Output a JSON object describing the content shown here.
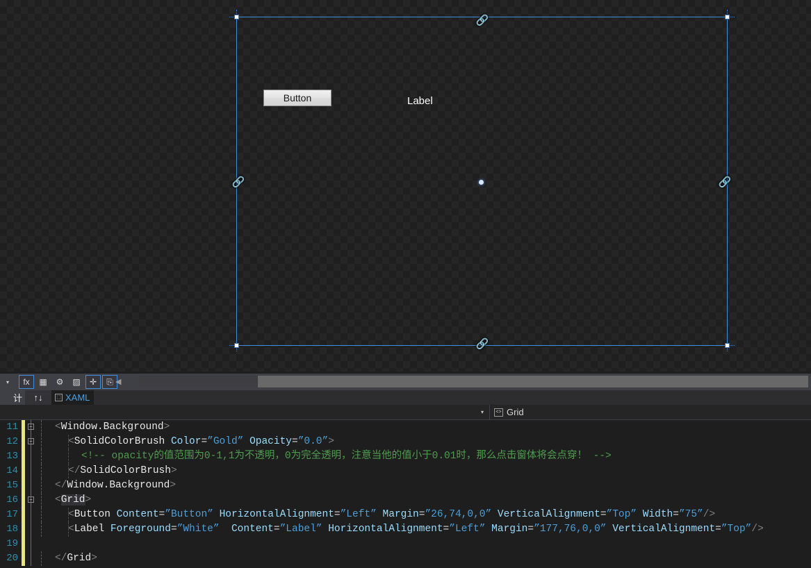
{
  "app": {
    "theme_bg": "#1e1e1e",
    "accent": "#3f8fe0",
    "selection_blue": "#2f6fbf"
  },
  "design_surface": {
    "controls": [
      {
        "name": "button",
        "text": "Button"
      },
      {
        "name": "label",
        "text": "Label"
      }
    ],
    "anchors": {
      "top_chain": "🔗",
      "bottom_chain": "🔗",
      "left_chain": "🔗",
      "right_chain": "🔗"
    }
  },
  "toolbar": {
    "combo_caret": "▾",
    "buttons": [
      {
        "name": "effects-fx",
        "glyph": "fx",
        "selected": true
      },
      {
        "name": "grid-view",
        "glyph": "▦",
        "selected": false
      },
      {
        "name": "snap-settings",
        "glyph": "⚙",
        "selected": false
      },
      {
        "name": "transparency-grid",
        "glyph": "▨",
        "selected": false
      },
      {
        "name": "snap-to-guides",
        "glyph": "✛",
        "selected": true
      },
      {
        "name": "snap-to-gridlines",
        "glyph": "⎘",
        "selected": true
      }
    ],
    "collapse_arrow": "◀"
  },
  "tabs": {
    "design_label": "计",
    "swap_icon": "↑↓",
    "xaml_label": "XAML",
    "xaml_glyph": "⬚"
  },
  "navbar": {
    "left_value": "",
    "left_caret": "▾",
    "right_glyph": "<>",
    "right_value": "Grid"
  },
  "editor": {
    "lines": [
      {
        "number": "11",
        "changed": true,
        "outline": "collapse",
        "indent": 1,
        "tokens": [
          {
            "t": "punct",
            "s": "<"
          },
          {
            "t": "elem",
            "s": "Window.Background"
          },
          {
            "t": "punct",
            "s": ">"
          }
        ]
      },
      {
        "number": "12",
        "changed": true,
        "outline": "collapse",
        "indent": 2,
        "tokens": [
          {
            "t": "punct",
            "s": "<"
          },
          {
            "t": "elem",
            "s": "SolidColorBrush"
          },
          {
            "t": "plain",
            "s": " "
          },
          {
            "t": "attr",
            "s": "Color"
          },
          {
            "t": "eq",
            "s": "="
          },
          {
            "t": "val",
            "s": "”Gold”"
          },
          {
            "t": "plain",
            "s": " "
          },
          {
            "t": "attr",
            "s": "Opacity"
          },
          {
            "t": "eq",
            "s": "="
          },
          {
            "t": "val",
            "s": "”0.0”"
          },
          {
            "t": "punct",
            "s": ">"
          }
        ]
      },
      {
        "number": "13",
        "changed": true,
        "outline": "none",
        "indent": 3,
        "tokens": [
          {
            "t": "comment",
            "s": "<!-- opacity的值范围为0-1,1为不透明，0为完全透明，注意当他的值小于0.01时，那么点击窗体将会点穿！ -->"
          }
        ]
      },
      {
        "number": "14",
        "changed": true,
        "outline": "none",
        "indent": 2,
        "tokens": [
          {
            "t": "punct",
            "s": "</"
          },
          {
            "t": "elem",
            "s": "SolidColorBrush"
          },
          {
            "t": "punct",
            "s": ">"
          }
        ]
      },
      {
        "number": "15",
        "changed": true,
        "outline": "end",
        "indent": 1,
        "tokens": [
          {
            "t": "punct",
            "s": "</"
          },
          {
            "t": "elem",
            "s": "Window.Background"
          },
          {
            "t": "punct",
            "s": ">"
          }
        ]
      },
      {
        "number": "16",
        "changed": true,
        "outline": "collapse",
        "indent": 1,
        "tokens": [
          {
            "t": "punct",
            "s": "<"
          },
          {
            "t": "elem-hl",
            "s": "Grid"
          },
          {
            "t": "punct",
            "s": ">"
          }
        ]
      },
      {
        "number": "17",
        "changed": true,
        "outline": "none",
        "indent": 2,
        "tokens": [
          {
            "t": "punct",
            "s": "<"
          },
          {
            "t": "elem",
            "s": "Button"
          },
          {
            "t": "plain",
            "s": " "
          },
          {
            "t": "attr",
            "s": "Content"
          },
          {
            "t": "eq",
            "s": "="
          },
          {
            "t": "val",
            "s": "”Button”"
          },
          {
            "t": "plain",
            "s": " "
          },
          {
            "t": "attr",
            "s": "HorizontalAlignment"
          },
          {
            "t": "eq",
            "s": "="
          },
          {
            "t": "val",
            "s": "”Left”"
          },
          {
            "t": "plain",
            "s": " "
          },
          {
            "t": "attr",
            "s": "Margin"
          },
          {
            "t": "eq",
            "s": "="
          },
          {
            "t": "val",
            "s": "”26,74,0,0”"
          },
          {
            "t": "plain",
            "s": " "
          },
          {
            "t": "attr",
            "s": "VerticalAlignment"
          },
          {
            "t": "eq",
            "s": "="
          },
          {
            "t": "val",
            "s": "”Top”"
          },
          {
            "t": "plain",
            "s": " "
          },
          {
            "t": "attr",
            "s": "Width"
          },
          {
            "t": "eq",
            "s": "="
          },
          {
            "t": "val",
            "s": "”75”"
          },
          {
            "t": "punct",
            "s": "/>"
          }
        ]
      },
      {
        "number": "18",
        "changed": true,
        "outline": "none",
        "indent": 2,
        "tokens": [
          {
            "t": "punct",
            "s": "<"
          },
          {
            "t": "elem",
            "s": "Label"
          },
          {
            "t": "plain",
            "s": " "
          },
          {
            "t": "attr",
            "s": "Foreground"
          },
          {
            "t": "eq",
            "s": "="
          },
          {
            "t": "val",
            "s": "”White”"
          },
          {
            "t": "plain",
            "s": "  "
          },
          {
            "t": "attr",
            "s": "Content"
          },
          {
            "t": "eq",
            "s": "="
          },
          {
            "t": "val",
            "s": "”Label”"
          },
          {
            "t": "plain",
            "s": " "
          },
          {
            "t": "attr",
            "s": "HorizontalAlignment"
          },
          {
            "t": "eq",
            "s": "="
          },
          {
            "t": "val",
            "s": "”Left”"
          },
          {
            "t": "plain",
            "s": " "
          },
          {
            "t": "attr",
            "s": "Margin"
          },
          {
            "t": "eq",
            "s": "="
          },
          {
            "t": "val",
            "s": "”177,76,0,0”"
          },
          {
            "t": "plain",
            "s": " "
          },
          {
            "t": "attr",
            "s": "VerticalAlignment"
          },
          {
            "t": "eq",
            "s": "="
          },
          {
            "t": "val",
            "s": "”Top”"
          },
          {
            "t": "punct",
            "s": "/>"
          }
        ]
      },
      {
        "number": "19",
        "changed": true,
        "outline": "none",
        "indent": 0,
        "tokens": []
      },
      {
        "number": "20",
        "changed": true,
        "outline": "none",
        "indent": 1,
        "tokens": [
          {
            "t": "punct",
            "s": "</"
          },
          {
            "t": "elem",
            "s": "Grid"
          },
          {
            "t": "punct",
            "s": ">"
          }
        ]
      }
    ]
  }
}
